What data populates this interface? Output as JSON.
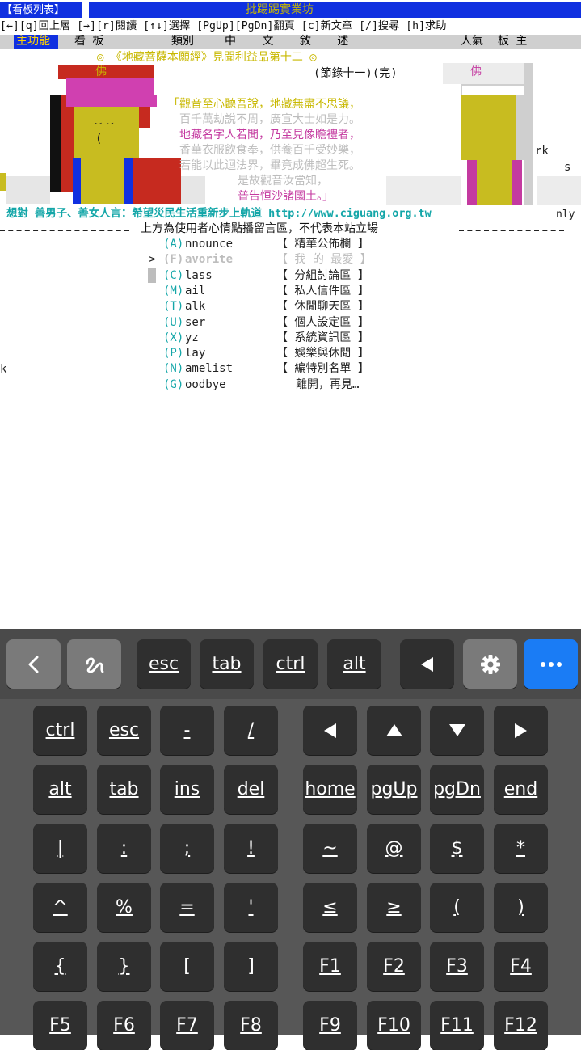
{
  "terminal": {
    "header_left": "【看板列表】",
    "header_title": "批踢踢實業坊",
    "help_line": "[←][q]回上層 [→][r]閱讀 [↑↓]選擇 [PgUp][PgDn]翻頁 [c]新文章 [/]搜尋 [h]求助",
    "column_header": {
      "tag": "主功能",
      "board": "看 板",
      "class": "類別",
      "title": "中 文 敘 述",
      "popularity": "人氣",
      "moderator": "板 主"
    },
    "art": {
      "title_line": "◎ 《地藏菩薩本願經》見聞利益品第十二 ◎",
      "subtitle": "(節錄十一)(完)",
      "buddha_left": "佛",
      "buddha_right": "佛",
      "verse": [
        "「觀音至心聽吾說，地藏無盡不思議，",
        "百千萬劫說不周，廣宣大士如是力。",
        "地藏名字人若聞，乃至見像瞻禮者，",
        "香華衣服飲食奉，供養百千受妙樂，",
        "若能以此迴法界，畢竟成佛超生死。",
        "是故觀音汝當知，",
        "普告恒沙諸國土。」"
      ],
      "side_text_1": "rk",
      "side_text_2": "s",
      "wish_line": "想對 善男子、善女人言：希望災民生活重新步上軌道 http://www.ciguang.org.tw",
      "wish_tail": "nly",
      "disclaimer": "上方為使用者心情點播留言區，不代表本站立場"
    },
    "menu": [
      {
        "key": "(A)",
        "name": "nnounce",
        "desc": "【 精華公佈欄 】",
        "dim": false,
        "cursor": ""
      },
      {
        "key": "(F)",
        "name": "avorite",
        "desc": "【 我 的 最愛 】",
        "dim": true,
        "cursor": ">"
      },
      {
        "key": "(C)",
        "name": "lass",
        "desc": "【 分組討論區 】",
        "dim": false,
        "cursor": ""
      },
      {
        "key": "(M)",
        "name": "ail",
        "desc": "【 私人信件區 】",
        "dim": false,
        "cursor": ""
      },
      {
        "key": "(T)",
        "name": "alk",
        "desc": "【 休閒聊天區 】",
        "dim": false,
        "cursor": ""
      },
      {
        "key": "(U)",
        "name": "ser",
        "desc": "【 個人設定區 】",
        "dim": false,
        "cursor": ""
      },
      {
        "key": "(X)",
        "name": "yz",
        "desc": "【 系統資訊區 】",
        "dim": false,
        "cursor": ""
      },
      {
        "key": "(P)",
        "name": "lay",
        "desc": "【 娛樂與休閒 】",
        "dim": false,
        "cursor": ""
      },
      {
        "key": "(N)",
        "name": "amelist",
        "desc": "【 編特別名單 】",
        "dim": false,
        "cursor": ""
      },
      {
        "key": "(G)",
        "name": "oodbye",
        "desc": "離開，再見…",
        "dim": false,
        "cursor": ""
      }
    ],
    "stray_k": "k"
  },
  "keyboard": {
    "toolbar": [
      "esc",
      "tab",
      "ctrl",
      "alt"
    ],
    "rows": [
      [
        "ctrl",
        "esc",
        "-",
        "/"
      ],
      [
        "alt",
        "tab",
        "ins",
        "del",
        "home",
        "pgUp",
        "pgDn",
        "end"
      ],
      [
        "|",
        ":",
        ";",
        "!",
        "~",
        "@",
        "$",
        "*"
      ],
      [
        "^",
        "%",
        "=",
        "'",
        "≤",
        "≥",
        "(",
        ")"
      ],
      [
        "{",
        "}",
        "[",
        "]",
        "F1",
        "F2",
        "F3",
        "F4"
      ],
      [
        "F5",
        "F6",
        "F7",
        "F8",
        "F9",
        "F10",
        "F11",
        "F12"
      ]
    ],
    "icons": {
      "back": "chevron-left-icon",
      "draw": "squiggle-icon",
      "left": "arrow-left-icon",
      "settings": "gear-icon",
      "more": "more-icon"
    },
    "colors": {
      "accent": "#1a7cf5",
      "key": "#2f2f2f",
      "panel": "#575757"
    }
  }
}
